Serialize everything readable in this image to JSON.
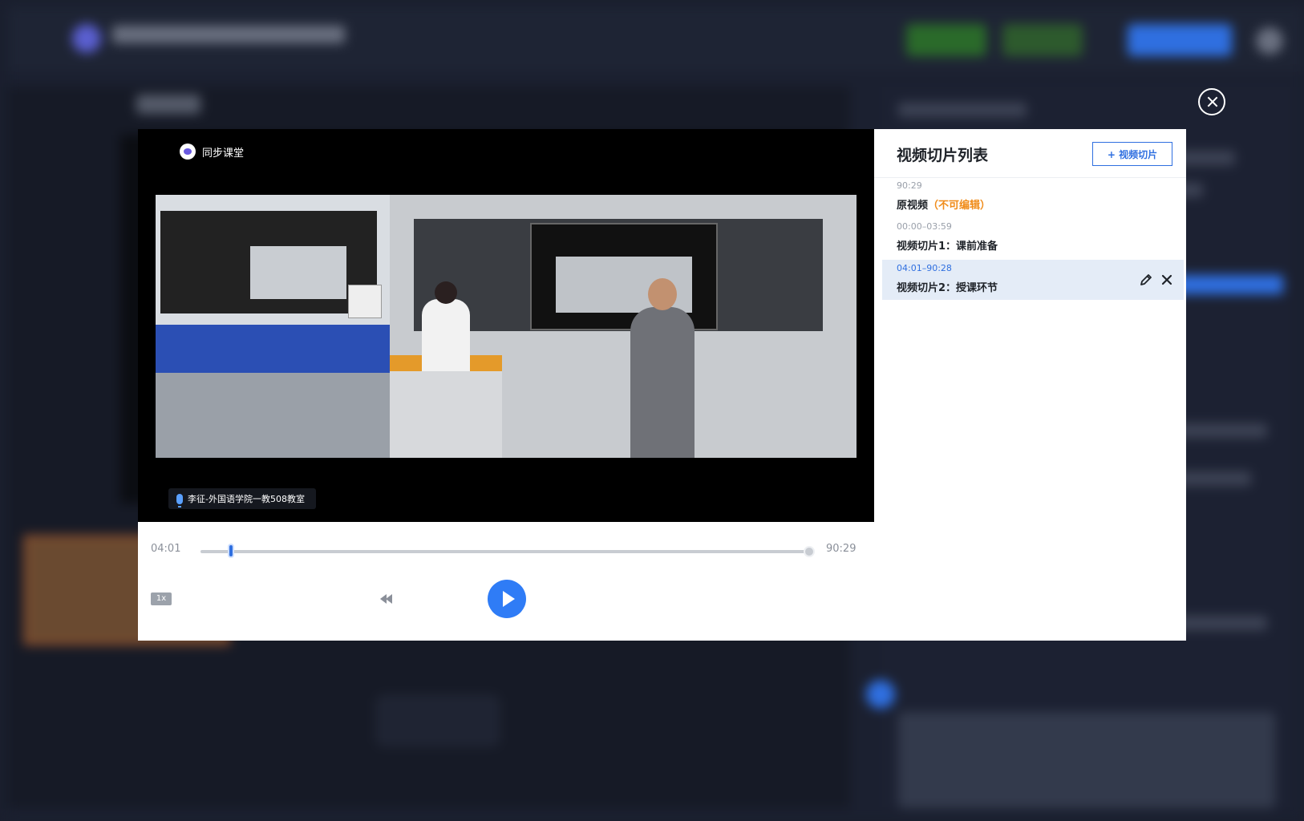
{
  "player": {
    "brand_label": "同步课堂",
    "room_label": "李征-外国语学院一教508教室",
    "current_time": "04:01",
    "total_time": "90:29",
    "speed": "1x",
    "clip_start_fraction": 0.045,
    "clip_end_fraction": 1.0
  },
  "clips": {
    "title": "视频切片列表",
    "add_button": "+ 视频切片",
    "items": [
      {
        "range": "90:29",
        "name": "原视频",
        "note": "（不可编辑）"
      },
      {
        "range": "00:00–03:59",
        "name": "视频切片1：课前准备",
        "note": ""
      },
      {
        "range": "04:01–90:28",
        "name": "视频切片2：授课环节",
        "note": ""
      }
    ]
  },
  "colors": {
    "accent": "#2f6fe0",
    "warning": "#f08c1a",
    "active_row": "#e4ecf7"
  }
}
